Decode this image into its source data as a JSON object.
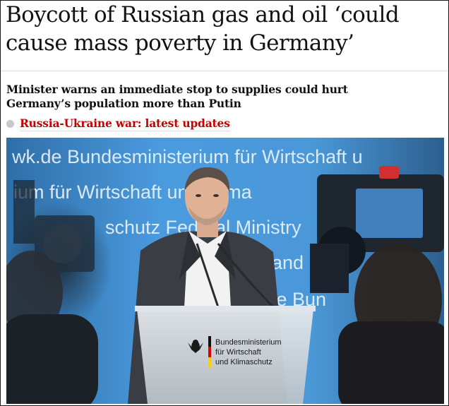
{
  "article": {
    "headline_line1": "Boycott of Russian gas and oil ‘could",
    "headline_line2": "cause mass poverty in Germany’",
    "standfirst_line1": "Minister warns an immediate stop to supplies could hurt",
    "standfirst_line2": "Germany’s population more than Putin",
    "related_link": "Russia-Ukraine war: latest updates"
  },
  "photo": {
    "backdrop_row1": "wk.de   Bundesministerium für Wirtschaft u",
    "backdrop_row2": "ium für Wirtschaft und Klima",
    "backdrop_row3": "schutz   Federal Ministry",
    "backdrop_row4": "and",
    "backdrop_row5": ".de   Bun",
    "podium_line1": "Bundesministerium",
    "podium_line2": "für Wirtschaft",
    "podium_line3": "und Klimaschutz",
    "colors": {
      "backdrop": "#3d8fd1",
      "backdrop_text": "#e8f2fb",
      "suit": "#3a3e44",
      "shirt": "#f2f2f2",
      "podium": "#cfd6dc",
      "flag_black": "#111111",
      "flag_red": "#dd0000",
      "flag_gold": "#ffce00"
    }
  }
}
